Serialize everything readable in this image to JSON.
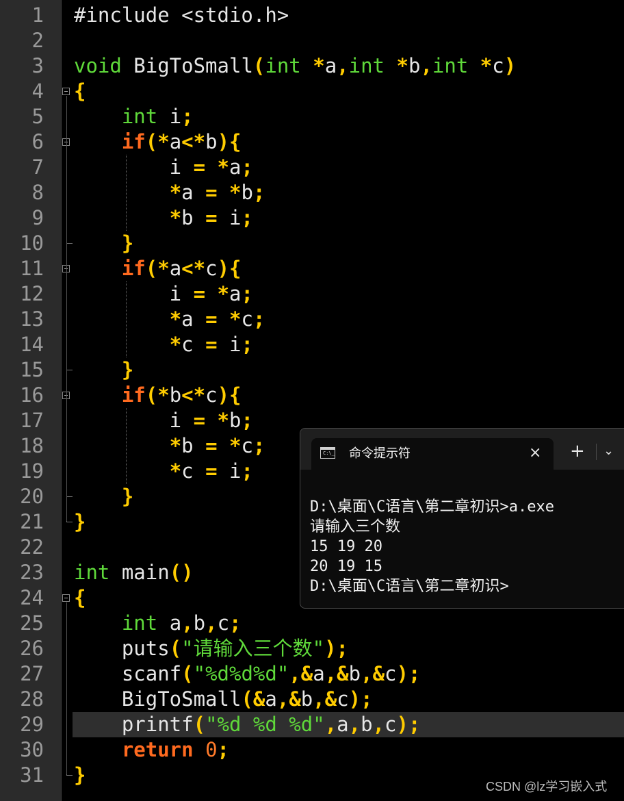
{
  "editor": {
    "line_numbers": [
      "1",
      "2",
      "3",
      "4",
      "5",
      "6",
      "7",
      "8",
      "9",
      "10",
      "11",
      "12",
      "13",
      "14",
      "15",
      "16",
      "17",
      "18",
      "19",
      "20",
      "21",
      "22",
      "23",
      "24",
      "25",
      "26",
      "27",
      "28",
      "29",
      "30",
      "31"
    ],
    "current_line": 29,
    "lines": [
      [
        [
          "#include <stdio.h>",
          "d"
        ]
      ],
      [],
      [
        [
          "void",
          "k"
        ],
        [
          " BigToSmall",
          "d"
        ],
        [
          "(",
          "o"
        ],
        [
          "int",
          "k"
        ],
        [
          " ",
          "d"
        ],
        [
          "*",
          "o"
        ],
        [
          "a",
          "d"
        ],
        [
          ",",
          "o"
        ],
        [
          "int",
          "k"
        ],
        [
          " ",
          "d"
        ],
        [
          "*",
          "o"
        ],
        [
          "b",
          "d"
        ],
        [
          ",",
          "o"
        ],
        [
          "int",
          "k"
        ],
        [
          " ",
          "d"
        ],
        [
          "*",
          "o"
        ],
        [
          "c",
          "d"
        ],
        [
          ")",
          "o"
        ]
      ],
      [
        [
          "{",
          "o"
        ]
      ],
      [
        [
          "    ",
          "d"
        ],
        [
          "int",
          "k"
        ],
        [
          " i",
          "d"
        ],
        [
          ";",
          "o"
        ]
      ],
      [
        [
          "    ",
          "d"
        ],
        [
          "if",
          "r"
        ],
        [
          "(",
          "o"
        ],
        [
          "*",
          "o"
        ],
        [
          "a",
          "d"
        ],
        [
          "<",
          "o"
        ],
        [
          "*",
          "o"
        ],
        [
          "b",
          "d"
        ],
        [
          ")",
          "o"
        ],
        [
          "{",
          "o"
        ]
      ],
      [
        [
          "        i ",
          "d"
        ],
        [
          "=",
          "o"
        ],
        [
          " ",
          "d"
        ],
        [
          "*",
          "o"
        ],
        [
          "a",
          "d"
        ],
        [
          ";",
          "o"
        ]
      ],
      [
        [
          "        ",
          "d"
        ],
        [
          "*",
          "o"
        ],
        [
          "a ",
          "d"
        ],
        [
          "=",
          "o"
        ],
        [
          " ",
          "d"
        ],
        [
          "*",
          "o"
        ],
        [
          "b",
          "d"
        ],
        [
          ";",
          "o"
        ]
      ],
      [
        [
          "        ",
          "d"
        ],
        [
          "*",
          "o"
        ],
        [
          "b ",
          "d"
        ],
        [
          "=",
          "o"
        ],
        [
          " i",
          "d"
        ],
        [
          ";",
          "o"
        ]
      ],
      [
        [
          "    ",
          "d"
        ],
        [
          "}",
          "o"
        ]
      ],
      [
        [
          "    ",
          "d"
        ],
        [
          "if",
          "r"
        ],
        [
          "(",
          "o"
        ],
        [
          "*",
          "o"
        ],
        [
          "a",
          "d"
        ],
        [
          "<",
          "o"
        ],
        [
          "*",
          "o"
        ],
        [
          "c",
          "d"
        ],
        [
          ")",
          "o"
        ],
        [
          "{",
          "o"
        ]
      ],
      [
        [
          "        i ",
          "d"
        ],
        [
          "=",
          "o"
        ],
        [
          " ",
          "d"
        ],
        [
          "*",
          "o"
        ],
        [
          "a",
          "d"
        ],
        [
          ";",
          "o"
        ]
      ],
      [
        [
          "        ",
          "d"
        ],
        [
          "*",
          "o"
        ],
        [
          "a ",
          "d"
        ],
        [
          "=",
          "o"
        ],
        [
          " ",
          "d"
        ],
        [
          "*",
          "o"
        ],
        [
          "c",
          "d"
        ],
        [
          ";",
          "o"
        ]
      ],
      [
        [
          "        ",
          "d"
        ],
        [
          "*",
          "o"
        ],
        [
          "c ",
          "d"
        ],
        [
          "=",
          "o"
        ],
        [
          " i",
          "d"
        ],
        [
          ";",
          "o"
        ]
      ],
      [
        [
          "    ",
          "d"
        ],
        [
          "}",
          "o"
        ]
      ],
      [
        [
          "    ",
          "d"
        ],
        [
          "if",
          "r"
        ],
        [
          "(",
          "o"
        ],
        [
          "*",
          "o"
        ],
        [
          "b",
          "d"
        ],
        [
          "<",
          "o"
        ],
        [
          "*",
          "o"
        ],
        [
          "c",
          "d"
        ],
        [
          ")",
          "o"
        ],
        [
          "{",
          "o"
        ]
      ],
      [
        [
          "        i ",
          "d"
        ],
        [
          "=",
          "o"
        ],
        [
          " ",
          "d"
        ],
        [
          "*",
          "o"
        ],
        [
          "b",
          "d"
        ],
        [
          ";",
          "o"
        ]
      ],
      [
        [
          "        ",
          "d"
        ],
        [
          "*",
          "o"
        ],
        [
          "b ",
          "d"
        ],
        [
          "=",
          "o"
        ],
        [
          " ",
          "d"
        ],
        [
          "*",
          "o"
        ],
        [
          "c",
          "d"
        ],
        [
          ";",
          "o"
        ]
      ],
      [
        [
          "        ",
          "d"
        ],
        [
          "*",
          "o"
        ],
        [
          "c ",
          "d"
        ],
        [
          "=",
          "o"
        ],
        [
          " i",
          "d"
        ],
        [
          ";",
          "o"
        ]
      ],
      [
        [
          "    ",
          "d"
        ],
        [
          "}",
          "o"
        ]
      ],
      [
        [
          "}",
          "o"
        ]
      ],
      [],
      [
        [
          "int",
          "k"
        ],
        [
          " main",
          "d"
        ],
        [
          "()",
          "o"
        ]
      ],
      [
        [
          "{",
          "o"
        ]
      ],
      [
        [
          "    ",
          "d"
        ],
        [
          "int",
          "k"
        ],
        [
          " a",
          "d"
        ],
        [
          ",",
          "o"
        ],
        [
          "b",
          "d"
        ],
        [
          ",",
          "o"
        ],
        [
          "c",
          "d"
        ],
        [
          ";",
          "o"
        ]
      ],
      [
        [
          "    puts",
          "d"
        ],
        [
          "(",
          "o"
        ],
        [
          "\"请输入三个数\"",
          "s"
        ],
        [
          ")",
          "o"
        ],
        [
          ";",
          "o"
        ]
      ],
      [
        [
          "    scanf",
          "d"
        ],
        [
          "(",
          "o"
        ],
        [
          "\"%d%d%d\"",
          "s"
        ],
        [
          ",",
          "o"
        ],
        [
          "&",
          "o"
        ],
        [
          "a",
          "d"
        ],
        [
          ",",
          "o"
        ],
        [
          "&",
          "o"
        ],
        [
          "b",
          "d"
        ],
        [
          ",",
          "o"
        ],
        [
          "&",
          "o"
        ],
        [
          "c",
          "d"
        ],
        [
          ")",
          "o"
        ],
        [
          ";",
          "o"
        ]
      ],
      [
        [
          "    BigToSmall",
          "d"
        ],
        [
          "(",
          "o"
        ],
        [
          "&",
          "o"
        ],
        [
          "a",
          "d"
        ],
        [
          ",",
          "o"
        ],
        [
          "&",
          "o"
        ],
        [
          "b",
          "d"
        ],
        [
          ",",
          "o"
        ],
        [
          "&",
          "o"
        ],
        [
          "c",
          "d"
        ],
        [
          ")",
          "o"
        ],
        [
          ";",
          "o"
        ]
      ],
      [
        [
          "    printf",
          "d"
        ],
        [
          "(",
          "o"
        ],
        [
          "\"%d %d %d\"",
          "s"
        ],
        [
          ",",
          "o"
        ],
        [
          "a",
          "d"
        ],
        [
          ",",
          "o"
        ],
        [
          "b",
          "d"
        ],
        [
          ",",
          "o"
        ],
        [
          "c",
          "d"
        ],
        [
          ")",
          "o"
        ],
        [
          ";",
          "o"
        ]
      ],
      [
        [
          "    ",
          "d"
        ],
        [
          "return",
          "r"
        ],
        [
          " ",
          "d"
        ],
        [
          "0",
          "n"
        ],
        [
          ";",
          "o"
        ]
      ],
      [
        [
          "}",
          "o"
        ]
      ]
    ]
  },
  "terminal": {
    "tab_title": "命令提示符",
    "close_icon": "×",
    "new_tab_icon": "+",
    "dropdown_icon": "⌄",
    "icon_text": "C:\\_",
    "lines": [
      "D:\\桌面\\C语言\\第二章初识>a.exe",
      "请输入三个数",
      "15 19 20",
      "20 19 15",
      "D:\\桌面\\C语言\\第二章初识>"
    ]
  },
  "watermark": "CSDN @lz学习嵌入式",
  "colors": {
    "keyword": "#5fd93a",
    "control": "#ff6a1f",
    "operator": "#ffcc00",
    "string": "#5fd93a",
    "number": "#ff7a2a",
    "default": "#e6e6e6",
    "background": "#000000",
    "gutter": "#2b2b2b"
  }
}
